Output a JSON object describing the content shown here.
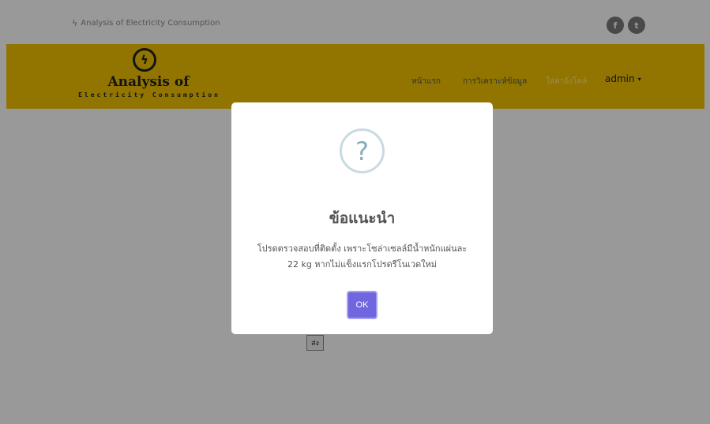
{
  "topbar": {
    "brand_text": "Analysis of Electricity Consumption",
    "bolt_glyph": "ϟ",
    "social": [
      {
        "icon": "facebook-icon",
        "glyph": "f"
      },
      {
        "icon": "twitter-icon",
        "glyph": "t"
      }
    ]
  },
  "logo": {
    "bolt_glyph": "ϟ",
    "title": "Analysis of",
    "subtitle": "Electricity Consumption"
  },
  "nav": {
    "items": [
      {
        "label": "หน้าแรก"
      },
      {
        "label": "การวิเคราะห์ข้อมูล"
      },
      {
        "label": "ใส่ค่าอ้งโคล์"
      }
    ],
    "user": "admin",
    "caret": "▾"
  },
  "form": {
    "send_label": "ส่ง"
  },
  "modal": {
    "icon_glyph": "?",
    "title": "ข้อแนะนำ",
    "line1": "โปรดตรวจสอบที่ติดตั้ง เพราะโซล่าเซลล์มีน้ำหนักแผ่นละ",
    "line2": "22 kg หากไม่แข็งแรกโปรดรีโนเวดใหม่",
    "ok_label": "OK"
  },
  "colors": {
    "navbar": "#f2c300",
    "ok_button": "#7066e0",
    "question_icon": "#87adbd"
  }
}
